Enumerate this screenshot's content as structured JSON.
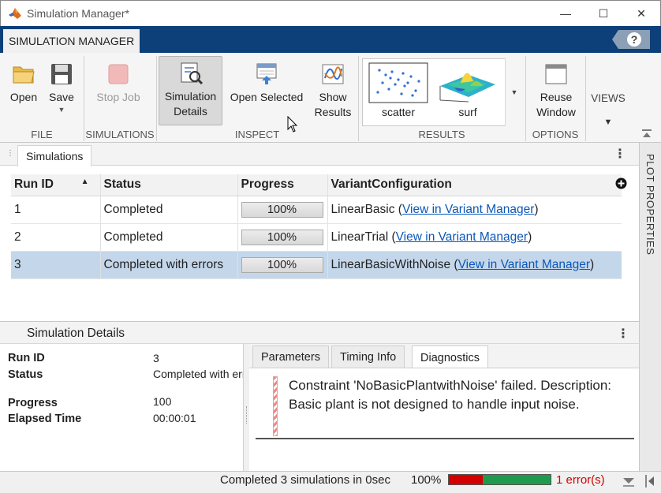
{
  "window": {
    "title": "Simulation Manager*",
    "minimize": "—",
    "maximize": "☐",
    "close": "✕"
  },
  "toolstrip": {
    "tab": "SIMULATION MANAGER",
    "help": "?"
  },
  "ribbon": {
    "open": "Open",
    "save": "Save",
    "stop_job": "Stop Job",
    "simulation_details_1": "Simulation",
    "simulation_details_2": "Details",
    "open_selected": "Open Selected",
    "show_results_1": "Show",
    "show_results_2": "Results",
    "scatter": "scatter",
    "surf": "surf",
    "reuse_window_1": "Reuse",
    "reuse_window_2": "Window",
    "views": "VIEWS",
    "groups": {
      "file": "FILE",
      "simulations": "SIMULATIONS",
      "inspect": "INSPECT",
      "results": "RESULTS",
      "options": "OPTIONS"
    }
  },
  "side_panel": {
    "label": "PLOT PROPERTIES"
  },
  "simulations": {
    "tab": "Simulations",
    "columns": {
      "run_id": "Run ID",
      "status": "Status",
      "progress": "Progress",
      "variant": "VariantConfiguration"
    },
    "link_text": "View in Variant Manager",
    "rows": [
      {
        "run_id": "1",
        "status": "Completed",
        "progress": "100%",
        "variant": "LinearBasic",
        "open_paren": " (",
        "close_paren": ")"
      },
      {
        "run_id": "2",
        "status": "Completed",
        "progress": "100%",
        "variant": "LinearTrial",
        "open_paren": " (",
        "close_paren": ")"
      },
      {
        "run_id": "3",
        "status": "Completed with errors",
        "progress": "100%",
        "variant": "LinearBasicWithNoise",
        "open_paren": " (",
        "close_paren": ")"
      }
    ]
  },
  "details": {
    "title": "Simulation Details",
    "labels": {
      "run_id": "Run ID",
      "status": "Status",
      "progress": "Progress",
      "elapsed": "Elapsed Time"
    },
    "values": {
      "run_id": "3",
      "status": "Completed with errors",
      "progress": "100",
      "elapsed": "00:00:01"
    },
    "tabs": {
      "parameters": "Parameters",
      "timing": "Timing Info",
      "diagnostics": "Diagnostics"
    },
    "diagnostic_message": "Constraint 'NoBasicPlantwithNoise' failed. Description: Basic plant is not designed to handle input noise."
  },
  "status_bar": {
    "text": "Completed 3 simulations in 0sec",
    "percent": "100%",
    "error_fraction": 0.33,
    "errors": "1 error(s)"
  },
  "colors": {
    "accent": "#0d3f79",
    "selection": "#c4d7ea",
    "error": "#d40000",
    "success": "#1f9a4f",
    "link": "#0b57b8"
  }
}
